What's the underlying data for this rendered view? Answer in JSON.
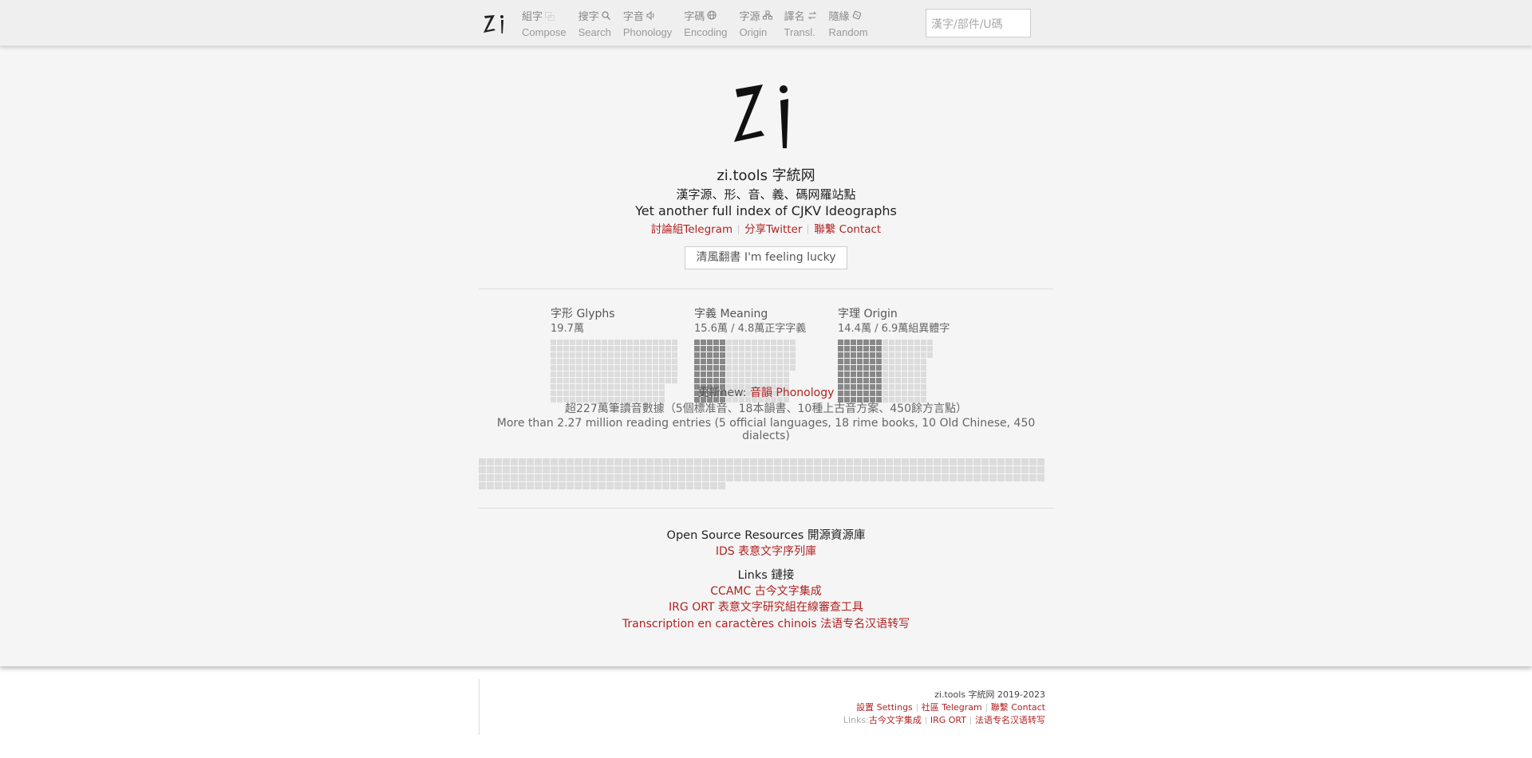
{
  "nav": {
    "items": [
      {
        "zh": "組字",
        "en": "Compose",
        "icon": "compose-icon",
        "glyph": "⿻"
      },
      {
        "zh": "搜字",
        "en": "Search",
        "icon": "search-icon",
        "glyph": "⚲"
      },
      {
        "zh": "字音",
        "en": "Phonology",
        "icon": "speaker-icon",
        "glyph": "🔈︎"
      },
      {
        "zh": "字碼",
        "en": "Encoding",
        "icon": "globe-icon",
        "glyph": "◍"
      },
      {
        "zh": "字源",
        "en": "Origin",
        "icon": "hierarchy-icon",
        "glyph": "品"
      },
      {
        "zh": "譯名",
        "en": "Transl.",
        "icon": "swap-icon",
        "glyph": "⇄"
      },
      {
        "zh": "隨緣",
        "en": "Random",
        "icon": "dice-icon",
        "glyph": "◈"
      }
    ],
    "search_placeholder": "漢字/部件/U碼"
  },
  "hero": {
    "title": "zi.tools 字統网",
    "subtitle_zh": "漢字源、形、音、義、碼网羅站點",
    "subtitle_en": "Yet another full index of CJKV Ideographs",
    "links": [
      "討論組Telegram",
      "分享Twitter",
      "聯繫 Contact"
    ],
    "lucky_button": "清風翻書 I'm feeling lucky"
  },
  "stats": [
    {
      "title": "字形 Glyphs",
      "count": "19.7萬",
      "filled_fraction": 0.0
    },
    {
      "title": "字義 Meaning",
      "count": "15.6萬 / 4.8萬正字字義",
      "filled_fraction": 0.31
    },
    {
      "title": "字理 Origin",
      "count": "14.4萬 / 6.9萬組異體字",
      "filled_fraction": 0.48
    }
  ],
  "update": {
    "prefix": "更新new: ",
    "link": "音韻 Phonology",
    "line_zh": "超227萬筆讀音數據（5個標准音、18本韻書、10種上古音方案、450餘方言點）",
    "line_en": "More than 2.27 million reading entries (5 official languages, 18 rime books, 10 Old Chinese, 450 dialects)"
  },
  "resources": {
    "open_source_heading": "Open Source Resources 開源資源庫",
    "open_source_links": [
      "IDS 表意文字序列庫"
    ],
    "links_heading": "Links 鏈接",
    "links": [
      "CCAMC 古今文字集成",
      "IRG ORT 表意文字研究組在線審查工具",
      "Transcription en caractères chinois 法语专名汉语转写"
    ]
  },
  "footer": {
    "copyright": "zi.tools 字統网 2019-2023",
    "row1": [
      "設置 Settings",
      "社區 Telegram",
      "聯繫 Contact"
    ],
    "links_label": "Links:",
    "row2": [
      "古今文字集成",
      "IRG ORT",
      "法语专名汉语转写"
    ]
  },
  "colors": {
    "accent": "#b22222",
    "cell_light": "#dcdcdc",
    "cell_dark": "#888888"
  }
}
